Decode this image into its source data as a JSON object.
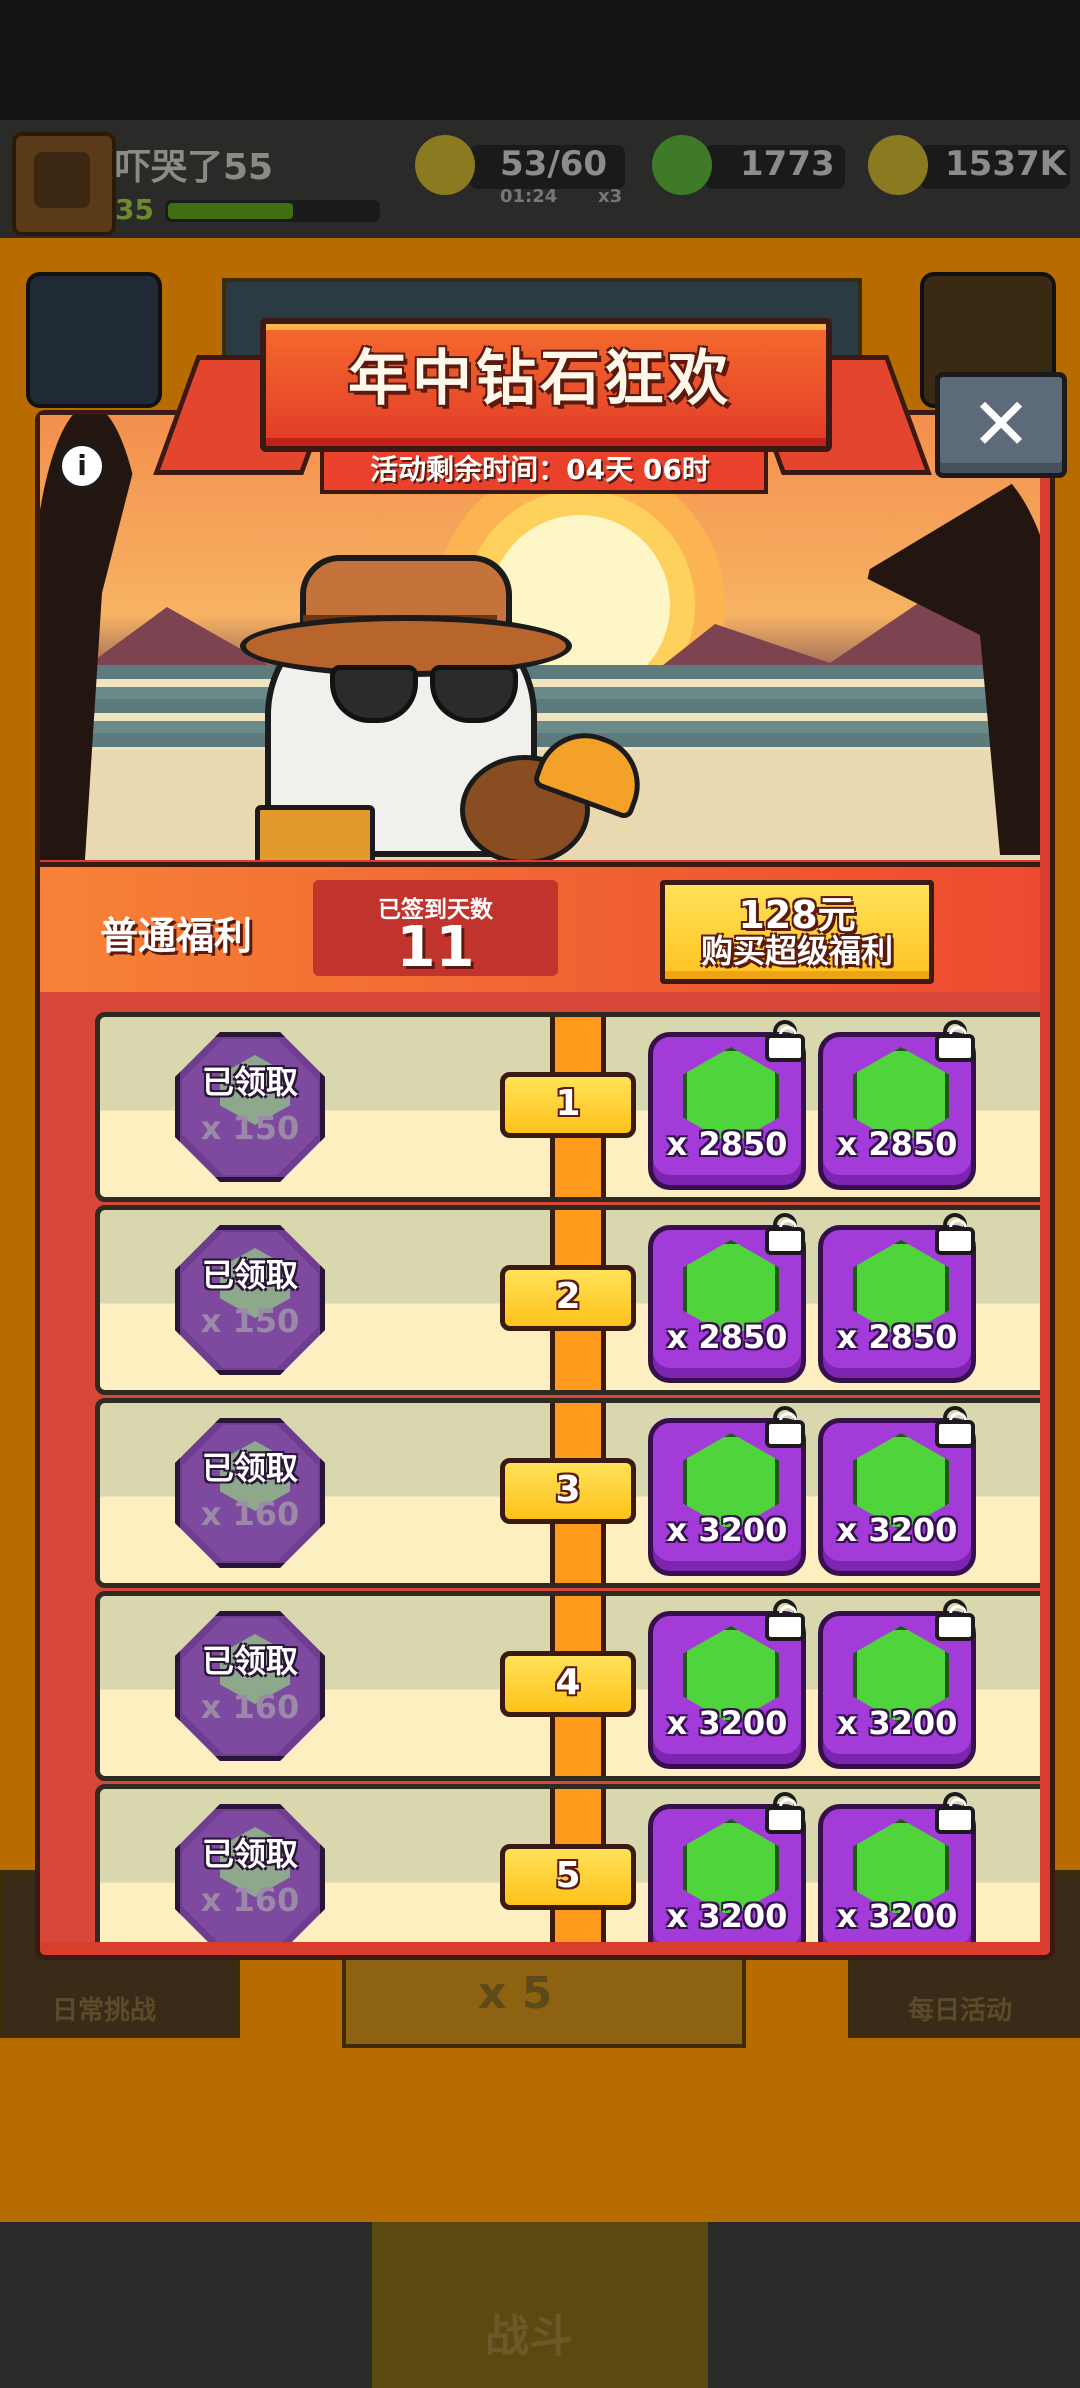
{
  "status": {
    "player_name": "吓哭了55",
    "player_level": "35"
  },
  "resources": {
    "energy": "53/60",
    "energy_timer": "01:24",
    "energy_multiplier": "x3",
    "gems": "1773",
    "coins": "1537K"
  },
  "underlay": {
    "daily_challenge": "日常挑战",
    "daily_activity": "每日活动",
    "energy_cost": "x 5",
    "battle": "战斗"
  },
  "modal": {
    "title": "年中钻石狂欢",
    "remaining_time": "活动剩余时间：04天 06时",
    "normal_label": "普通福利",
    "signed_days_label": "已签到天数",
    "signed_days_value": "11",
    "super_price": "128元",
    "super_label": "购买超级福利"
  },
  "rows": [
    {
      "day": "1",
      "claimed_label": "已领取",
      "free_qty": "x 150",
      "super_qty_a": "x 2850",
      "super_qty_b": "x 2850"
    },
    {
      "day": "2",
      "claimed_label": "已领取",
      "free_qty": "x 150",
      "super_qty_a": "x 2850",
      "super_qty_b": "x 2850"
    },
    {
      "day": "3",
      "claimed_label": "已领取",
      "free_qty": "x 160",
      "super_qty_a": "x 3200",
      "super_qty_b": "x 3200"
    },
    {
      "day": "4",
      "claimed_label": "已领取",
      "free_qty": "x 160",
      "super_qty_a": "x 3200",
      "super_qty_b": "x 3200"
    },
    {
      "day": "5",
      "claimed_label": "已领取",
      "free_qty": "x 160",
      "super_qty_a": "x 3200",
      "super_qty_b": "x 3200"
    }
  ],
  "colors": {
    "accent": "#e23c27",
    "gem": "#4fd43b",
    "reward_bg": "#a33bd9",
    "gold": "#ffc31f"
  }
}
